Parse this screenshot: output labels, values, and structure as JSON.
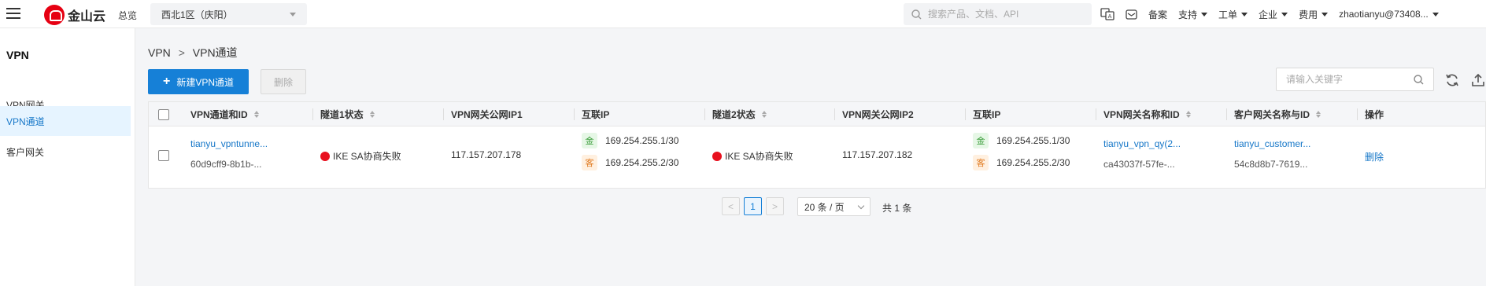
{
  "header": {
    "brand": "金山云",
    "overview": "总览",
    "region": "西北1区（庆阳）",
    "search_placeholder": "搜索产品、文档、API",
    "links": [
      "备案",
      "支持",
      "工单",
      "企业",
      "费用"
    ],
    "user": "zhaotianyu@73408..."
  },
  "sidebar": {
    "title": "VPN",
    "items": [
      {
        "label": "VPN网关"
      },
      {
        "label": "VPN通道"
      },
      {
        "label": "客户网关"
      }
    ]
  },
  "breadcrumb": {
    "root": "VPN",
    "separator": ">",
    "current": "VPN通道"
  },
  "toolbar": {
    "create_label": "新建VPN通道",
    "delete_label": "删除",
    "keyword_placeholder": "请输入关键字"
  },
  "table": {
    "columns": [
      "VPN通道和ID",
      "隧道1状态",
      "VPN网关公网IP1",
      "互联IP",
      "隧道2状态",
      "VPN网关公网IP2",
      "互联IP",
      "VPN网关名称和ID",
      "客户网关名称与ID",
      "操作"
    ],
    "rows": [
      {
        "name": "tianyu_vpntunne...",
        "id": "60d9cff9-8b1b-...",
        "tunnel1_status": "IKE SA协商失败",
        "gw_ip1": "117.157.207.178",
        "link1_tag_a": "金",
        "link1_ip_a": "169.254.255.1/30",
        "link1_tag_b": "客",
        "link1_ip_b": "169.254.255.2/30",
        "tunnel2_status": "IKE SA协商失败",
        "gw_ip2": "117.157.207.182",
        "link2_tag_a": "金",
        "link2_ip_a": "169.254.255.1/30",
        "link2_tag_b": "客",
        "link2_ip_b": "169.254.255.2/30",
        "vpn_gw_name": "tianyu_vpn_qy(2...",
        "vpn_gw_id": "ca43037f-57fe-...",
        "customer_gw_name": "tianyu_customer...",
        "customer_gw_id": "54c8d8b7-7619...",
        "action": "删除"
      }
    ]
  },
  "pagination": {
    "prev": "<",
    "current_page": "1",
    "next": ">",
    "page_size": "20 条 / 页",
    "total": "共 1 条"
  },
  "colors": {
    "primary": "#1680d7",
    "error": "#e8101e",
    "brand": "#e60012"
  }
}
